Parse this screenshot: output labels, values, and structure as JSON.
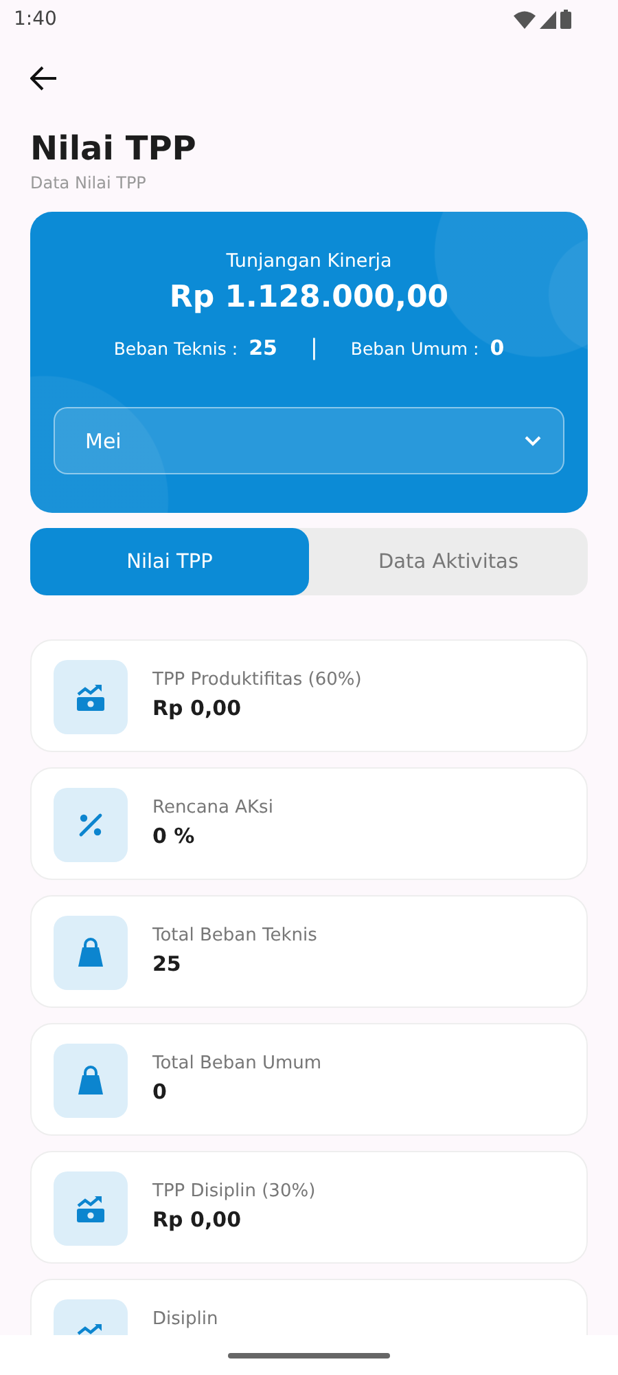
{
  "status_bar": {
    "time": "1:40"
  },
  "header": {
    "title": "Nilai TPP",
    "subtitle": "Data Nilai TPP"
  },
  "summary": {
    "label": "Tunjangan Kinerja",
    "amount": "Rp 1.128.000,00",
    "stats": [
      {
        "label": "Beban Teknis :",
        "value": "25"
      },
      {
        "label": "Beban Umum :",
        "value": "0"
      }
    ],
    "divider": "|",
    "month_select": {
      "value": "Mei"
    }
  },
  "tabs": [
    {
      "label": "Nilai TPP",
      "selected": true
    },
    {
      "label": "Data Aktivitas",
      "selected": false
    }
  ],
  "items": [
    {
      "kind": "money",
      "label": "TPP Produktifitas (60%)",
      "value": "Rp 0,00"
    },
    {
      "kind": "percent",
      "label": "Rencana AKsi",
      "value": "0 %"
    },
    {
      "kind": "bag",
      "label": "Total Beban Teknis",
      "value": "25"
    },
    {
      "kind": "bag",
      "label": "Total Beban Umum",
      "value": "0"
    },
    {
      "kind": "money",
      "label": "TPP Disiplin (30%)",
      "value": "Rp 0,00"
    },
    {
      "kind": "money",
      "label": "Disiplin"
    }
  ]
}
